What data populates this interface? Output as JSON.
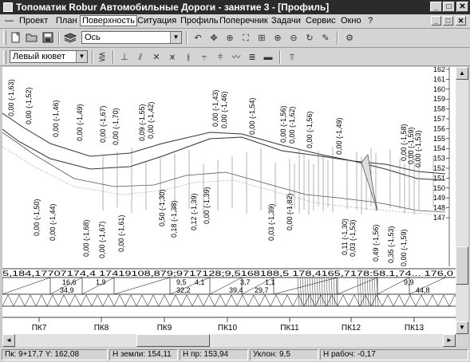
{
  "window": {
    "title": "Топоматик Robur Автомобильные Дороги - занятие 3 - [Профиль]",
    "minimize": "_",
    "maximize": "□",
    "close": "✕"
  },
  "menu": {
    "system": "—",
    "items": [
      "Проект",
      "План",
      "Поверхность",
      "Ситуация",
      "Профиль",
      "Поперечник",
      "Задачи",
      "Сервис",
      "Окно",
      "?"
    ],
    "mdi": [
      "_",
      "□",
      "✕"
    ]
  },
  "toolbar1": {
    "layer_combo": "Ось",
    "icons": [
      "undo-icon",
      "move-icon",
      "pan-icon",
      "zoom-window-icon",
      "zoom-in-icon",
      "zoom-out-icon",
      "refresh-icon",
      "edit-icon",
      "settings-icon"
    ]
  },
  "toolbar2": {
    "object_combo": "Левый кювет",
    "icons": [
      "ditch-icon",
      "slope-icon",
      "cross-icon",
      "intersect-icon",
      "vertical-icon",
      "level-icon",
      "wave-icon",
      "grid-icon",
      "line-icon",
      "axis-icon"
    ]
  },
  "profile": {
    "y_scale": [
      "162",
      "161",
      "160",
      "159",
      "158",
      "157",
      "156",
      "155",
      "154",
      "153",
      "152",
      "151",
      "150",
      "149",
      "148",
      "147"
    ],
    "elev_labels": [
      {
        "t": "0,00 (-1,63)"
      },
      {
        "t": "0,00 (-1,52)"
      },
      {
        "t": "0,00 (-1,46)"
      },
      {
        "t": "0,00 (-1,49)"
      },
      {
        "t": "0,00 (-1,67)"
      },
      {
        "t": "0,00 (-1,70)"
      },
      {
        "t": "0,09 (-1,55)"
      },
      {
        "t": "0,00 (-1,42)"
      },
      {
        "t": "0,00 (-1,43)"
      },
      {
        "t": "0,00 (-1,46)"
      },
      {
        "t": "0,00 (-1,54)"
      },
      {
        "t": "0,00 (-1,56)"
      },
      {
        "t": "0,00 (-1,62)"
      },
      {
        "t": "0,00 (-1,56)"
      },
      {
        "t": "0,00 (-1,49)"
      },
      {
        "t": "0,00 (-1,58)"
      },
      {
        "t": "0,00 (-1,59)"
      },
      {
        "t": "0,00 (-1,53)"
      }
    ],
    "low_labels": [
      {
        "t": "0,00 (-1,50)"
      },
      {
        "t": "0,00 (-1,44)"
      },
      {
        "t": "0,00 (-1,68)"
      },
      {
        "t": "0,00 (-1,67)"
      },
      {
        "t": "0,00 (-1,61)"
      },
      {
        "t": "0,50 (-1,30)"
      },
      {
        "t": "0,18 (-1,38)"
      },
      {
        "t": "0,12 (-1,39)"
      },
      {
        "t": "0,00 (-1,39)"
      },
      {
        "t": "0,03 (-1,39)"
      },
      {
        "t": "0,00 (-1,82)"
      },
      {
        "t": "0,11 (-1,30)"
      },
      {
        "t": "0,03 (-1,53)"
      },
      {
        "t": "0,49 (-1,56)"
      },
      {
        "t": "0,35 (-1,53)"
      },
      {
        "t": "0,00 (-1,59)"
      }
    ],
    "band_row1": "5,184,17707174,4  17419108,879;9717128;9,5168188,5  178,4165,7178:58.1,74... 176,0",
    "band_row2": [
      {
        "t": "16,6"
      },
      {
        "t": "34,9"
      },
      {
        "t": "1,9"
      },
      {
        "t": "9,5"
      },
      {
        "t": "32,2"
      },
      {
        "t": "4,1"
      },
      {
        "t": "3,7"
      },
      {
        "t": "39,4"
      },
      {
        "t": "1,1"
      },
      {
        "t": "29,7"
      },
      {
        "t": "9,9"
      },
      {
        "t": "44,8"
      }
    ],
    "pickets": [
      "ПК7",
      "ПК8",
      "ПК9",
      "ПК10",
      "ПК11",
      "ПК12",
      "ПК13"
    ]
  },
  "status": {
    "position": "Пк: 9+17,7  Y: 162,08",
    "ground": "Н земли: 154,11",
    "design": "Н пр: 153,94",
    "slope": "Уклон: 9,5",
    "work": "Н рабоч: -0,17"
  }
}
